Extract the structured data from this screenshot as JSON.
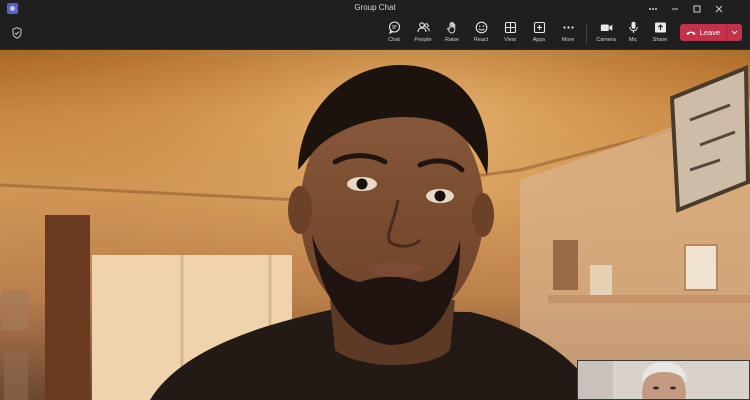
{
  "window": {
    "title": "Group Chat"
  },
  "toolbar": {
    "buttons": [
      {
        "key": "chat",
        "label": "Chat",
        "icon": "chat-icon"
      },
      {
        "key": "people",
        "label": "People",
        "icon": "people-icon"
      },
      {
        "key": "raise",
        "label": "Raise",
        "icon": "hand-icon"
      },
      {
        "key": "react",
        "label": "React",
        "icon": "smiley-icon"
      },
      {
        "key": "view",
        "label": "View",
        "icon": "grid-icon"
      },
      {
        "key": "apps",
        "label": "Apps",
        "icon": "plus-square-icon"
      },
      {
        "key": "more",
        "label": "More",
        "icon": "ellipsis-icon"
      },
      {
        "key": "camera",
        "label": "Camera",
        "icon": "camera-icon"
      },
      {
        "key": "mic",
        "label": "Mic",
        "icon": "mic-icon"
      },
      {
        "key": "share",
        "label": "Share",
        "icon": "share-icon"
      }
    ],
    "leave_label": "Leave"
  },
  "colors": {
    "leave": "#c4314b",
    "app_accent": "#5b5fc7",
    "chrome": "#1f1f1f"
  }
}
